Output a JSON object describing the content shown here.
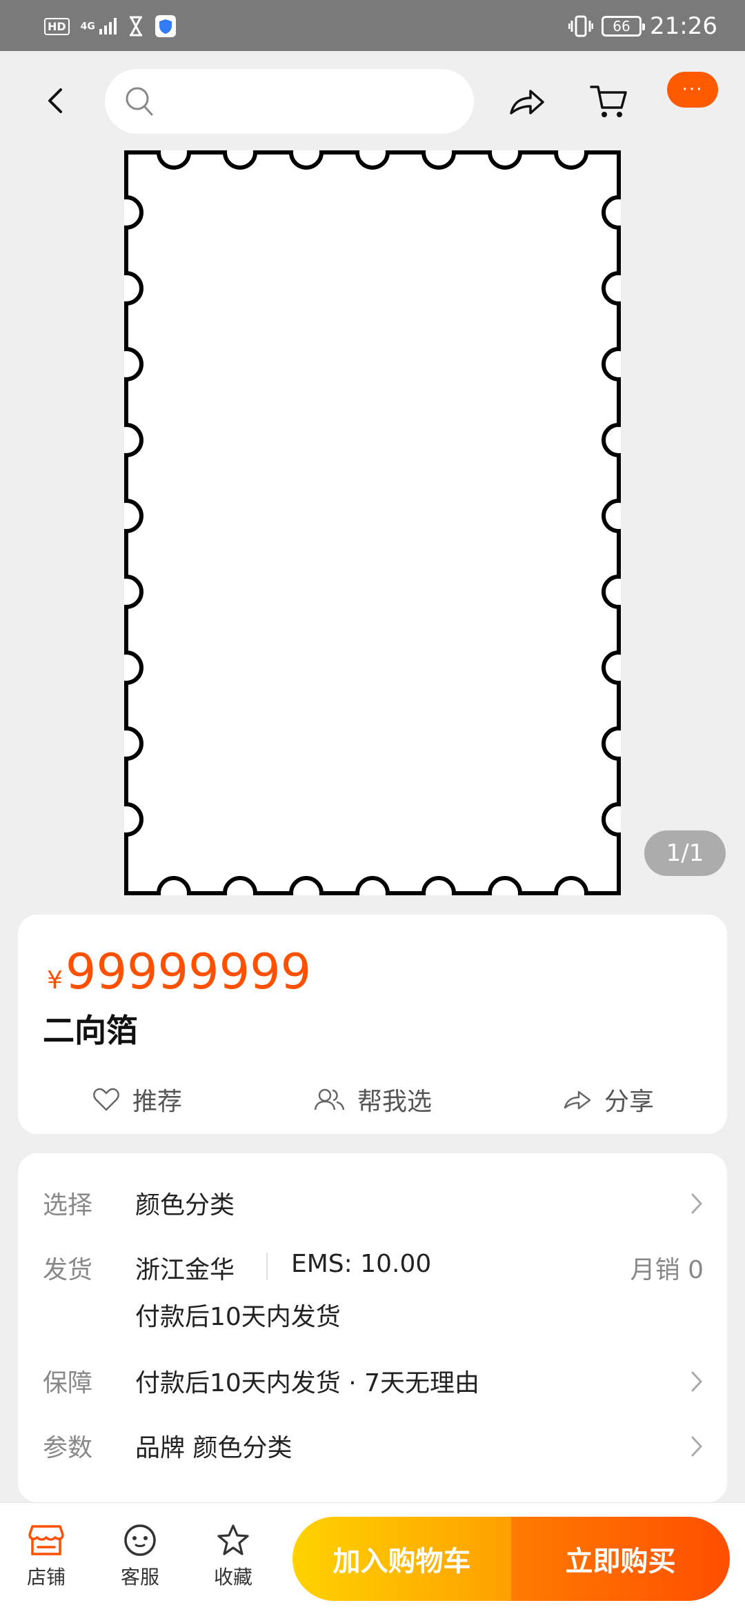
{
  "status_bar": {
    "left_badges": [
      "HD",
      "4G"
    ],
    "time": "21:26",
    "battery": "66"
  },
  "header": {
    "search_placeholder": "",
    "more_label": "···"
  },
  "gallery": {
    "counter": "1/1"
  },
  "product": {
    "currency": "¥",
    "price": "99999999",
    "title": "二向箔",
    "actions": {
      "recommend": "推荐",
      "help_choose": "帮我选",
      "share": "分享"
    }
  },
  "details": {
    "select_label": "选择",
    "select_value": "颜色分类",
    "shipping_label": "发货",
    "shipping_origin": "浙江金华",
    "shipping_fee": "EMS: 10.00",
    "monthly_sales": "月销  0",
    "shipping_time": "付款后10天内发货",
    "guarantee_label": "保障",
    "guarantee_value": "付款后10天内发货 · 7天无理由",
    "params_label": "参数",
    "params_value": "品牌 颜色分类"
  },
  "bottom_bar": {
    "shop_label": "店铺",
    "service_label": "客服",
    "favorite_label": "收藏",
    "add_to_cart": "加入购物车",
    "buy_now": "立即购买"
  },
  "colors": {
    "accent": "#ff5000",
    "cart_button": "#ffb400",
    "buy_button": "#ff5a00"
  }
}
